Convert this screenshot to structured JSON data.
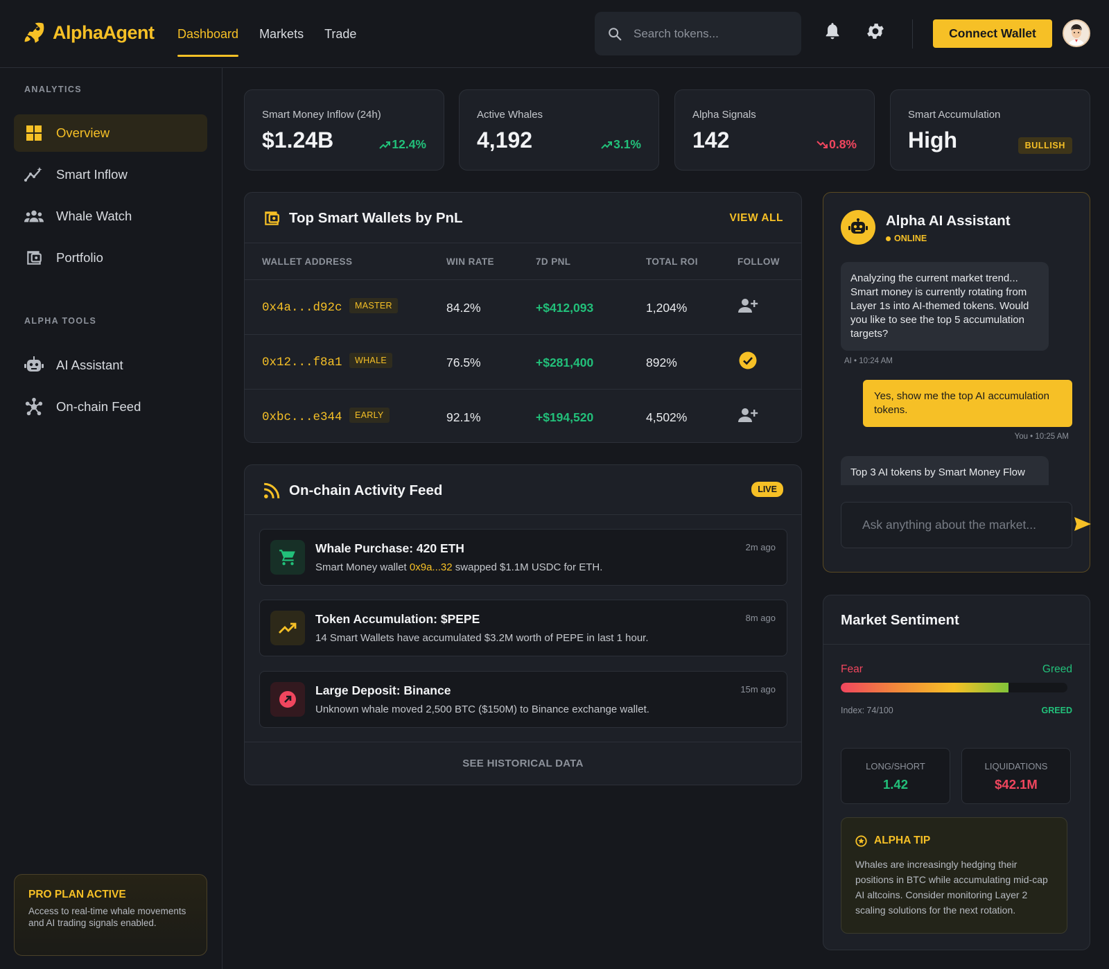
{
  "app": {
    "name": "AlphaAgent"
  },
  "nav": {
    "items": [
      "Dashboard",
      "Markets",
      "Trade"
    ]
  },
  "search": {
    "placeholder": "Search tokens..."
  },
  "header": {
    "connect_label": "Connect Wallet"
  },
  "sidebar": {
    "section1": "ANALYTICS",
    "items1": [
      "Overview",
      "Smart Inflow",
      "Whale Watch",
      "Portfolio"
    ],
    "section2": "ALPHA TOOLS",
    "items2": [
      "AI Assistant",
      "On-chain Feed"
    ],
    "pro": {
      "title": "PRO PLAN ACTIVE",
      "text": "Access to real-time whale movements and AI trading signals enabled."
    }
  },
  "stats": [
    {
      "label": "Smart Money Inflow (24h)",
      "value": "$1.24B",
      "change": "12.4%"
    },
    {
      "label": "Active Whales",
      "value": "4,192",
      "change": "3.1%"
    },
    {
      "label": "Alpha Signals",
      "value": "142",
      "change": "0.8%"
    },
    {
      "label": "Smart Accumulation",
      "value": "High",
      "badge": "BULLISH"
    }
  ],
  "wallets": {
    "title": "Top Smart Wallets by PnL",
    "view_all": "VIEW ALL",
    "headers": [
      "WALLET ADDRESS",
      "WIN RATE",
      "7D PNL",
      "TOTAL ROI",
      "FOLLOW"
    ],
    "rows": [
      {
        "address": "0x4a...d92c",
        "tag": "MASTER",
        "win_rate": "84.2%",
        "pnl": "+$412,093",
        "roi": "1,204%",
        "following": false
      },
      {
        "address": "0x12...f8a1",
        "tag": "WHALE",
        "win_rate": "76.5%",
        "pnl": "+$281,400",
        "roi": "892%",
        "following": true
      },
      {
        "address": "0xbc...e344",
        "tag": "EARLY",
        "win_rate": "92.1%",
        "pnl": "+$194,520",
        "roi": "4,502%",
        "following": false
      }
    ]
  },
  "feed": {
    "title": "On-chain Activity Feed",
    "live": "LIVE",
    "items": [
      {
        "title": "Whale Purchase: 420 ETH",
        "text_before": "Smart Money wallet ",
        "highlight": "0x9a...32",
        "text_after": " swapped $1.1M USDC for ETH.",
        "time": "2m ago"
      },
      {
        "title": "Token Accumulation: $PEPE",
        "text": "14 Smart Wallets have accumulated $3.2M worth of PEPE in last 1 hour.",
        "time": "8m ago"
      },
      {
        "title": "Large Deposit: Binance",
        "text": "Unknown whale moved 2,500 BTC ($150M) to Binance exchange wallet.",
        "time": "15m ago"
      }
    ],
    "see_historical": "SEE HISTORICAL DATA"
  },
  "ai": {
    "title": "Alpha AI Assistant",
    "status": "ONLINE",
    "messages": [
      {
        "from": "ai",
        "text": "Analyzing the current market trend... Smart money is currently rotating from Layer 1s into AI-themed tokens. Would you like to see the top 5 accumulation targets?",
        "meta": "AI • 10:24 AM"
      },
      {
        "from": "me",
        "text": "Yes, show me the top AI accumulation tokens.",
        "meta": "You • 10:25 AM"
      },
      {
        "from": "ai",
        "text": "Top 3 AI tokens by Smart Money Flow"
      }
    ],
    "input_placeholder": "Ask anything about the market..."
  },
  "sentiment": {
    "title": "Market Sentiment",
    "fear": "Fear",
    "greed": "Greed",
    "index_text": "Index: 74/100",
    "index_value": 74,
    "index_label": "GREED",
    "long_short_label": "LONG/SHORT",
    "long_short_value": "1.42",
    "liq_label": "LIQUIDATIONS",
    "liq_value": "$42.1M"
  },
  "tip": {
    "title": "ALPHA TIP",
    "text": "Whales are increasingly hedging their positions in BTC while accumulating mid-cap AI altcoins. Consider monitoring Layer 2 scaling solutions for the next rotation."
  },
  "colors": {
    "accent": "#f6c026",
    "up": "#22c07a",
    "down": "#f0465e",
    "bg": "#16181d",
    "card": "#1d2027"
  }
}
